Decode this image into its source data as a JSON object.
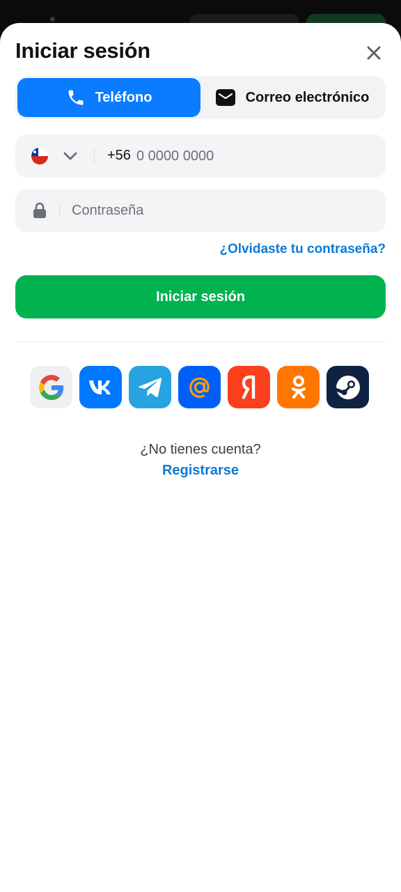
{
  "header": {
    "title": "Iniciar sesión"
  },
  "tabs": [
    {
      "label": "Teléfono",
      "icon": "phone-icon",
      "active": true
    },
    {
      "label": "Correo electrónico",
      "icon": "envelope-icon",
      "active": false
    }
  ],
  "phone": {
    "country_flag": "chile-flag-icon",
    "country_code": "+56",
    "placeholder": "0 0000 0000"
  },
  "password": {
    "placeholder": "Contraseña"
  },
  "forgot_link": "¿Olvidaste tu contraseña?",
  "submit_label": "Iniciar sesión",
  "social_logins": [
    {
      "name": "google",
      "icon": "google-icon",
      "color": "#eef0f3"
    },
    {
      "name": "vk",
      "icon": "vk-icon",
      "color": "#0077ff"
    },
    {
      "name": "telegram",
      "icon": "telegram-icon",
      "color": "#26a3e0"
    },
    {
      "name": "mail-ru",
      "icon": "at-sign-icon",
      "color": "#005ff9"
    },
    {
      "name": "yandex",
      "icon": "yandex-icon",
      "color": "#fc3f1d"
    },
    {
      "name": "odnoklassniki",
      "icon": "odnoklassniki-icon",
      "color": "#ff7700"
    },
    {
      "name": "steam",
      "icon": "steam-icon",
      "color": "#0f2244"
    }
  ],
  "footer": {
    "prompt": "¿No tienes cuenta?",
    "register_label": "Registrarse"
  },
  "colors": {
    "accent_blue": "#0a7cff",
    "link_blue": "#0a7ad8",
    "submit_green": "#00b34f"
  }
}
